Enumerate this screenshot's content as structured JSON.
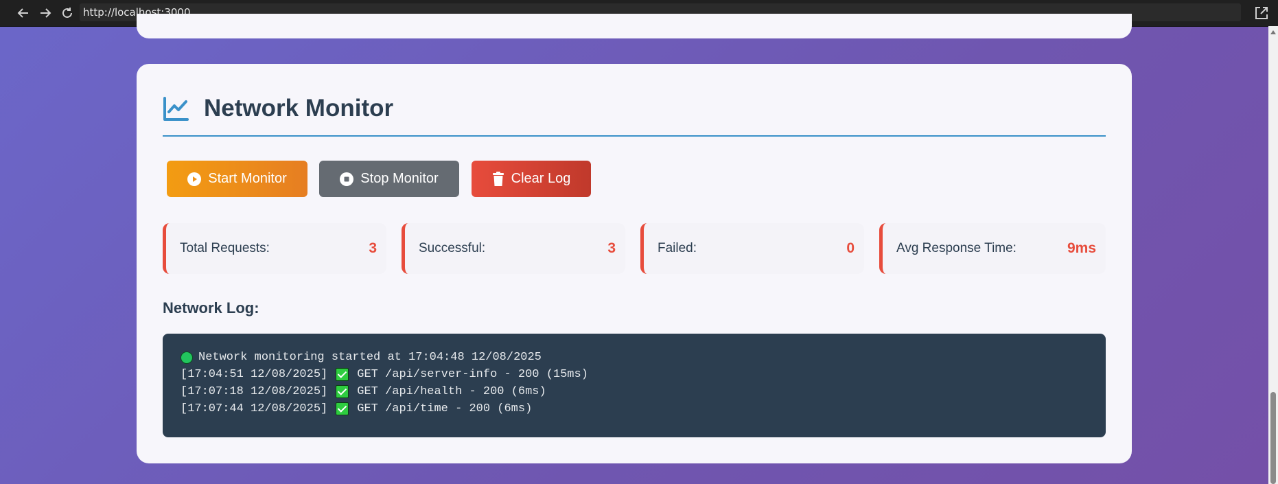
{
  "browser": {
    "url": "http://localhost:3000"
  },
  "section": {
    "title": "Network Monitor"
  },
  "buttons": {
    "start": "Start Monitor",
    "stop": "Stop Monitor",
    "clear": "Clear Log"
  },
  "stats": [
    {
      "label": "Total Requests:",
      "value": "3"
    },
    {
      "label": "Successful:",
      "value": "3"
    },
    {
      "label": "Failed:",
      "value": "0"
    },
    {
      "label": "Avg Response Time:",
      "value": "9ms"
    }
  ],
  "log": {
    "title": "Network Log:",
    "started": "Network monitoring started at 17:04:48 12/08/2025",
    "entries": [
      {
        "time": "[17:04:51 12/08/2025]",
        "text": "GET /api/server-info - 200 (15ms)"
      },
      {
        "time": "[17:07:18 12/08/2025]",
        "text": "GET /api/health - 200 (6ms)"
      },
      {
        "time": "[17:07:44 12/08/2025]",
        "text": "GET /api/time - 200 (6ms)"
      }
    ]
  },
  "colors": {
    "accent": "#e74c3c",
    "start_button": "#f39c12",
    "stop_button": "#656b72",
    "log_background": "#2c3e50",
    "heading_rule": "#3a91c9"
  },
  "icons": [
    "back-icon",
    "forward-icon",
    "reload-icon",
    "open-external-icon",
    "chart-line-icon",
    "play-circle-icon",
    "stop-circle-icon",
    "trash-icon",
    "green-circle-icon",
    "check-mark-icon"
  ]
}
